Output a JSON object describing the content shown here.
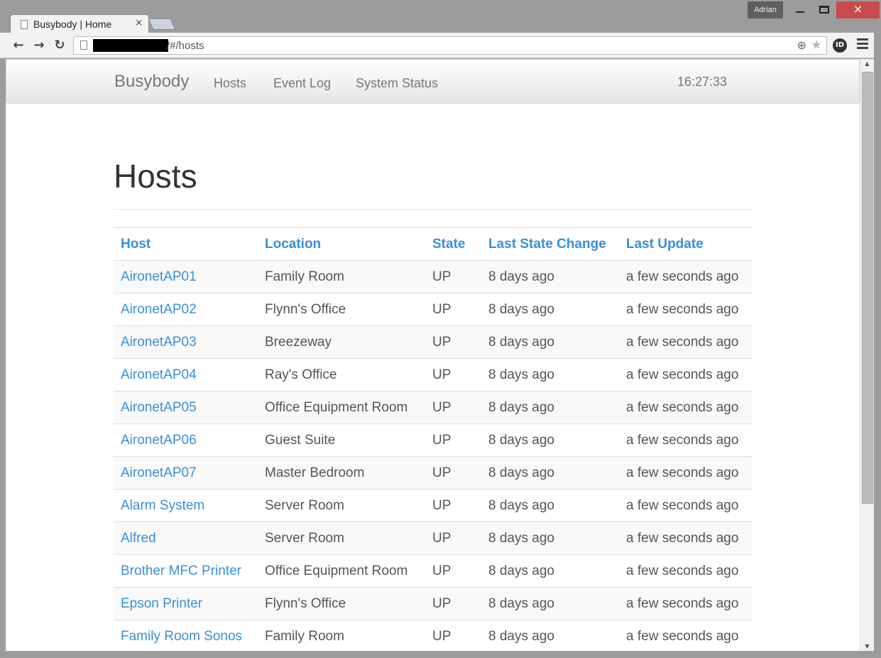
{
  "browser": {
    "tab_title": "Busybody | Home",
    "tab_close": "×",
    "profile_name": "Adrian",
    "url": "/#/hosts",
    "icons": {
      "back": "arrow-left-icon",
      "forward": "arrow-right-icon",
      "reload": "reload-icon",
      "zoom": "zoom-icon",
      "star": "star-icon",
      "extension": "extension-icon",
      "menu": "menu-icon"
    },
    "glyphs": {
      "back": "←",
      "forward": "→",
      "reload": "↻",
      "zoom": "⊕",
      "star": "★",
      "extension": "ID"
    },
    "close_color": "#c94c4c"
  },
  "navbar": {
    "brand": "Busybody",
    "links": [
      "Hosts",
      "Event Log",
      "System Status"
    ],
    "clock": "16:27:33"
  },
  "page": {
    "title": "Hosts"
  },
  "table": {
    "columns": [
      "Host",
      "Location",
      "State",
      "Last State Change",
      "Last Update"
    ],
    "rows": [
      [
        "AironetAP01",
        "Family Room",
        "UP",
        "8 days ago",
        "a few seconds ago"
      ],
      [
        "AironetAP02",
        "Flynn's Office",
        "UP",
        "8 days ago",
        "a few seconds ago"
      ],
      [
        "AironetAP03",
        "Breezeway",
        "UP",
        "8 days ago",
        "a few seconds ago"
      ],
      [
        "AironetAP04",
        "Ray's Office",
        "UP",
        "8 days ago",
        "a few seconds ago"
      ],
      [
        "AironetAP05",
        "Office Equipment Room",
        "UP",
        "8 days ago",
        "a few seconds ago"
      ],
      [
        "AironetAP06",
        "Guest Suite",
        "UP",
        "8 days ago",
        "a few seconds ago"
      ],
      [
        "AironetAP07",
        "Master Bedroom",
        "UP",
        "8 days ago",
        "a few seconds ago"
      ],
      [
        "Alarm System",
        "Server Room",
        "UP",
        "8 days ago",
        "a few seconds ago"
      ],
      [
        "Alfred",
        "Server Room",
        "UP",
        "8 days ago",
        "a few seconds ago"
      ],
      [
        "Brother MFC Printer",
        "Office Equipment Room",
        "UP",
        "8 days ago",
        "a few seconds ago"
      ],
      [
        "Epson Printer",
        "Flynn's Office",
        "UP",
        "8 days ago",
        "a few seconds ago"
      ],
      [
        "Family Room Sonos",
        "Family Room",
        "UP",
        "8 days ago",
        "a few seconds ago"
      ]
    ]
  },
  "colors": {
    "link": "#3a8fd9",
    "text": "#555555",
    "navbar_text": "#777777"
  }
}
